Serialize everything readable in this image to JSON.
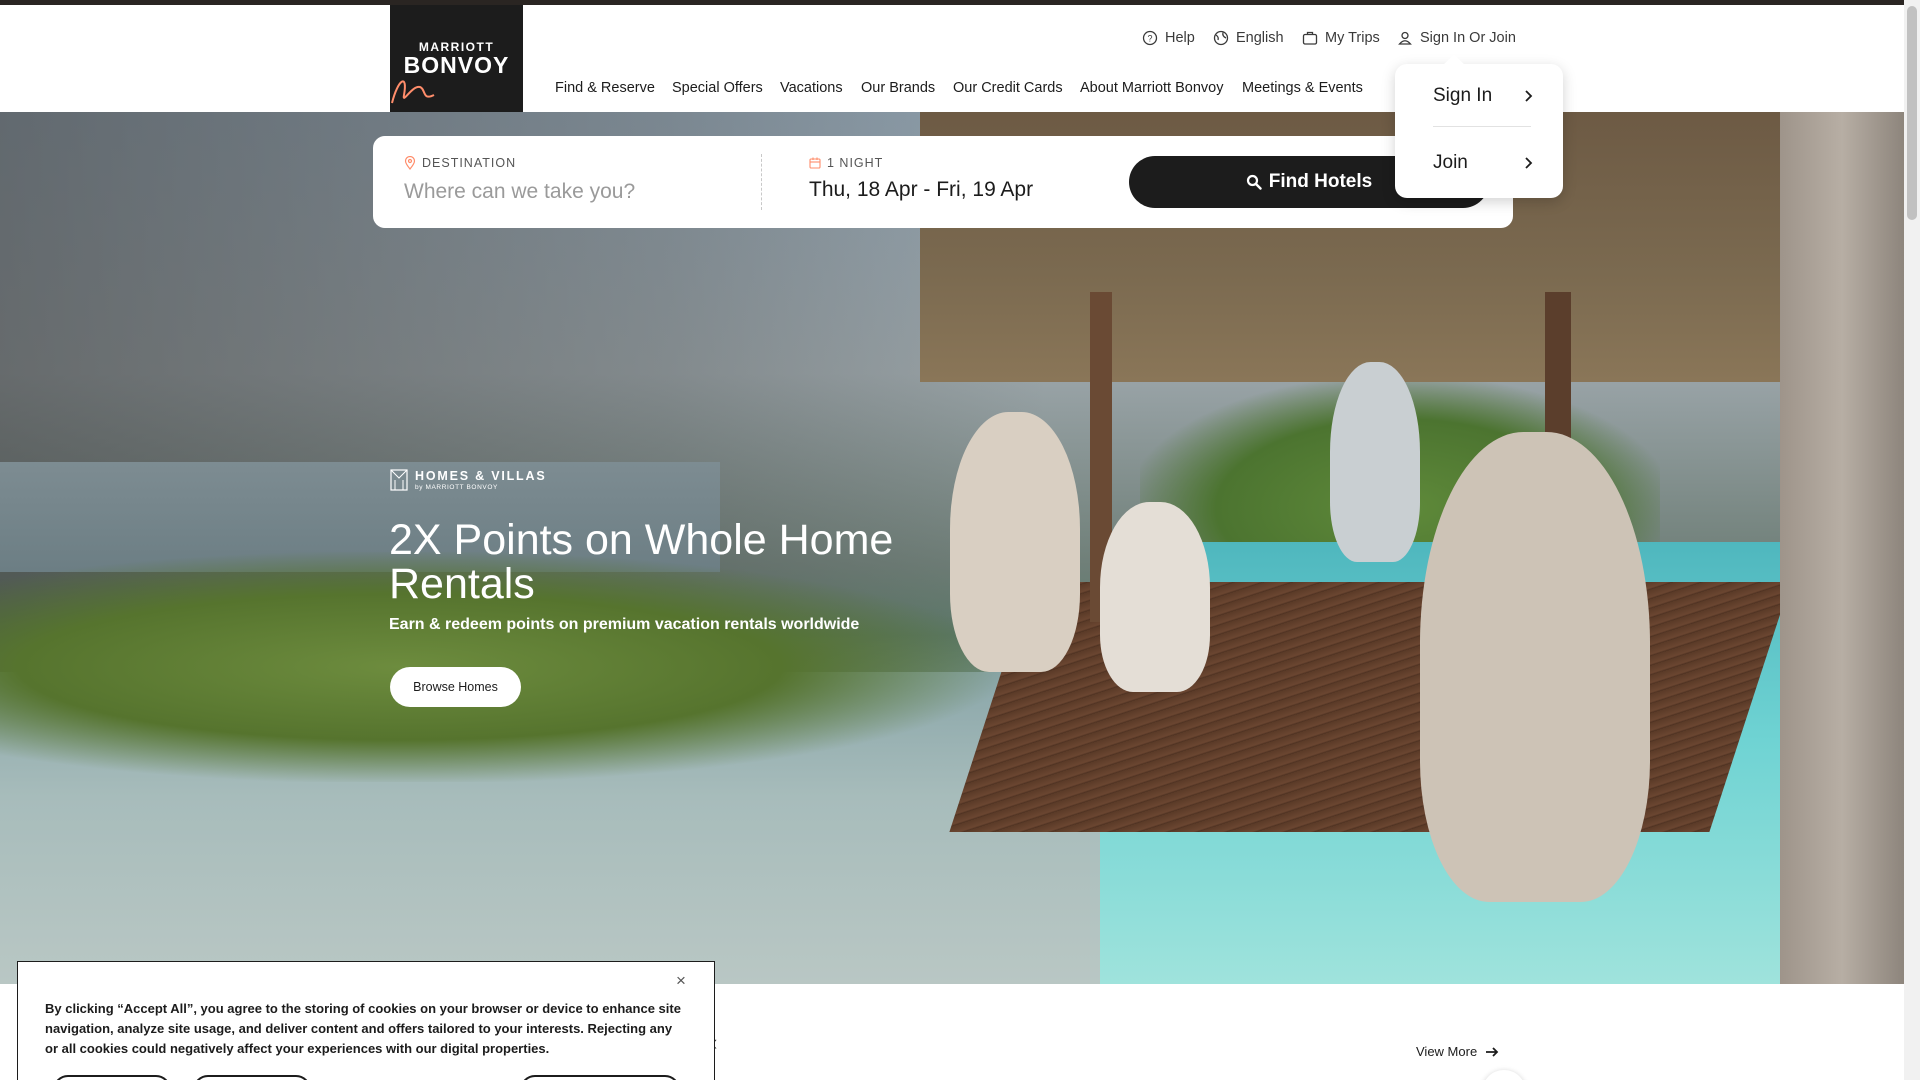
{
  "brand": {
    "line1": "MARRIOTT",
    "line2": "BONVOY"
  },
  "utility_nav": [
    {
      "label": "Help",
      "icon": "help-icon"
    },
    {
      "label": "English",
      "icon": "globe-icon"
    },
    {
      "label": "My Trips",
      "icon": "suitcase-icon"
    },
    {
      "label": "Sign In Or Join",
      "icon": "user-icon"
    }
  ],
  "main_nav": [
    "Find & Reserve",
    "Special Offers",
    "Vacations",
    "Our Brands",
    "Our Credit Cards",
    "About Marriott Bonvoy",
    "Meetings & Events"
  ],
  "search": {
    "destination_label": "DESTINATION",
    "destination_placeholder": "Where can we take you?",
    "nights_label": "1 NIGHT",
    "dates": "Thu, 18 Apr - Fri, 19 Apr",
    "find_button": "Find Hotels"
  },
  "account_menu": {
    "sign_in": "Sign In",
    "join": "Join"
  },
  "hero": {
    "sub_brand_line1": "HOMES & VILLAS",
    "sub_brand_line2": "by MARRIOTT BONVOY",
    "title": "2X Points on Whole Home Rentals",
    "subtitle": "Earn & redeem points on premium vacation rentals worldwide",
    "button": "Browse Homes"
  },
  "section": {
    "view_more": "View More"
  },
  "cookie_banner": {
    "close": "×",
    "text": "By clicking “Accept All”, you agree to the storing of cookies on your browser or device to enhance site navigation, analyze site usage, and deliver content and offers tailored to your interests. Rejecting any or all cookies could negatively affect your experiences with our digital properties."
  },
  "colors": {
    "brand_dark": "#1c1c1c",
    "accent": "#ff8d6b"
  }
}
